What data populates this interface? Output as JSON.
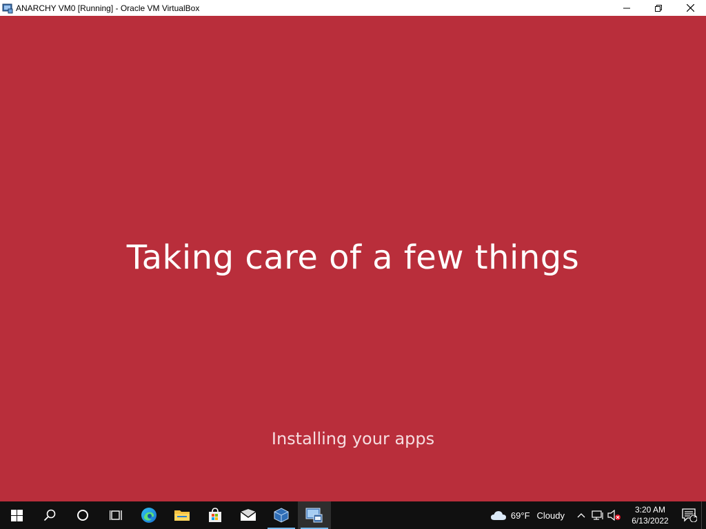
{
  "window": {
    "title": "ANARCHY VM0 [Running] - Oracle VM VirtualBox",
    "app_icon": "virtualbox-vm-icon",
    "controls": [
      "minimize-icon",
      "restore-icon",
      "close-icon"
    ]
  },
  "vm": {
    "background_color": "#b92e3b",
    "headline": "Taking care of a few things",
    "status": "Installing your apps"
  },
  "taskbar": {
    "pinned": [
      {
        "name": "start-button",
        "icon": "windows-logo-icon"
      },
      {
        "name": "search-button",
        "icon": "search-icon"
      },
      {
        "name": "cortana-button",
        "icon": "cortana-circle-icon"
      },
      {
        "name": "task-view-button",
        "icon": "task-view-icon"
      },
      {
        "name": "edge-button",
        "icon": "edge-icon"
      },
      {
        "name": "file-explorer-button",
        "icon": "folder-icon"
      },
      {
        "name": "store-button",
        "icon": "store-bag-icon"
      },
      {
        "name": "mail-button",
        "icon": "mail-icon"
      },
      {
        "name": "virtualbox-manager-button",
        "icon": "virtualbox-cube-icon"
      },
      {
        "name": "vm-window-button",
        "icon": "virtualbox-vm-icon",
        "active": true
      }
    ],
    "weather": {
      "icon": "cloud-icon",
      "temperature": "69°F",
      "condition": "Cloudy"
    },
    "tray": {
      "icons": [
        "chevron-up-icon",
        "network-icon",
        "volume-muted-icon"
      ]
    },
    "clock": {
      "time": "3:20 AM",
      "date": "6/13/2022"
    },
    "notifications": {
      "icon": "action-center-icon",
      "count": "1"
    }
  }
}
